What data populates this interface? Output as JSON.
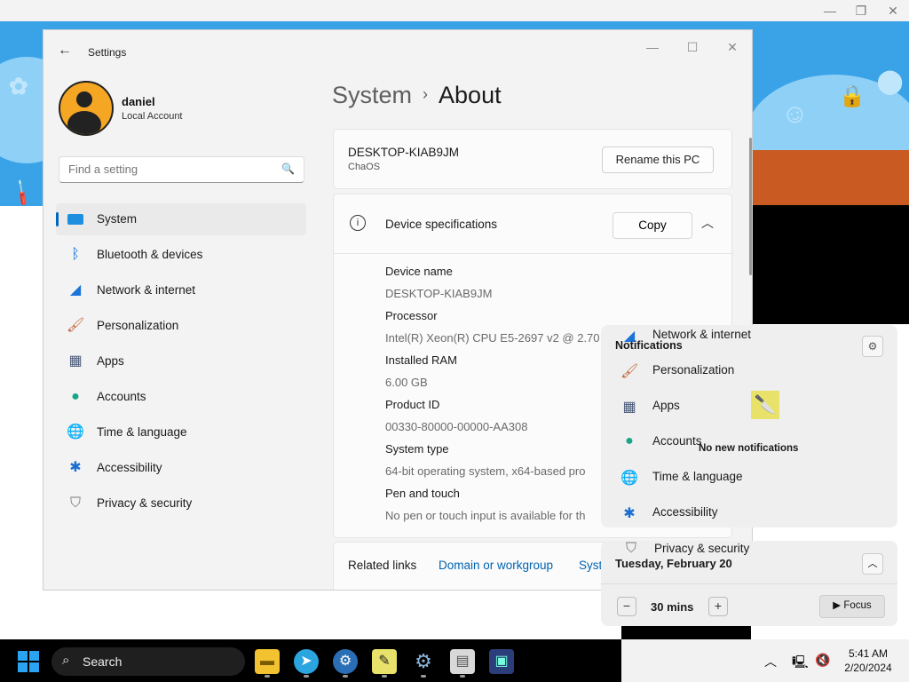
{
  "window": {
    "title": "Settings",
    "user": {
      "name": "daniel",
      "account_type": "Local Account"
    },
    "search": {
      "placeholder": "Find a setting"
    },
    "nav": [
      {
        "label": "System",
        "icon": "system-icon",
        "color": "#0067c0"
      },
      {
        "label": "Bluetooth & devices",
        "icon": "bluetooth-icon"
      },
      {
        "label": "Network & internet",
        "icon": "wifi-icon"
      },
      {
        "label": "Personalization",
        "icon": "brush-icon"
      },
      {
        "label": "Apps",
        "icon": "apps-icon"
      },
      {
        "label": "Accounts",
        "icon": "accounts-icon"
      },
      {
        "label": "Time & language",
        "icon": "globe-clock-icon"
      },
      {
        "label": "Accessibility",
        "icon": "accessibility-icon"
      },
      {
        "label": "Privacy & security",
        "icon": "shield-icon"
      }
    ],
    "breadcrumb": {
      "parent": "System",
      "current": "About"
    },
    "pc": {
      "name": "DESKTOP-KIAB9JM",
      "os": "ChaOS",
      "rename_label": "Rename this PC"
    },
    "specs": {
      "title": "Device specifications",
      "copy_label": "Copy",
      "items": [
        {
          "key": "Device name",
          "value": "DESKTOP-KIAB9JM"
        },
        {
          "key": "Processor",
          "value": "Intel(R) Xeon(R) CPU E5-2697 v2 @ 2.70"
        },
        {
          "key": "Installed RAM",
          "value": "6.00 GB"
        },
        {
          "key": "Product ID",
          "value": "00330-80000-00000-AA308"
        },
        {
          "key": "System type",
          "value": "64-bit operating system, x64-based pro"
        },
        {
          "key": "Pen and touch",
          "value": "No pen or touch input is available for th"
        }
      ]
    },
    "related": {
      "title": "Related links",
      "links": [
        "Domain or workgroup",
        "Syst"
      ]
    }
  },
  "notifications": {
    "title": "Notifications",
    "empty_text": "No new notifications",
    "ghost_items": [
      {
        "label": "Network & internet",
        "icon": "wifi-icon"
      },
      {
        "label": "Personalization",
        "icon": "brush-icon"
      },
      {
        "label": "Apps",
        "icon": "apps-icon"
      },
      {
        "label": "Accounts",
        "icon": "accounts-icon"
      },
      {
        "label": "Time & language",
        "icon": "globe-clock-icon"
      },
      {
        "label": "Accessibility",
        "icon": "accessibility-icon"
      }
    ]
  },
  "calendar": {
    "ghost_item": "Privacy & security",
    "date": "Tuesday, February 20",
    "focus_minutes": "30 mins",
    "focus_label": "Focus"
  },
  "taskbar": {
    "search_label": "Search",
    "apps": [
      "file-explorer-icon",
      "telegram-icon",
      "chrome-settings-icon",
      "paint-tool-icon",
      "settings-gear-icon",
      "document-icon",
      "monitor-icon"
    ],
    "time": "5:41 AM",
    "date": "2/20/2024"
  },
  "colors": {
    "accent": "#0067c0",
    "link": "#0063b1",
    "desktop": "#3aa3e8"
  }
}
